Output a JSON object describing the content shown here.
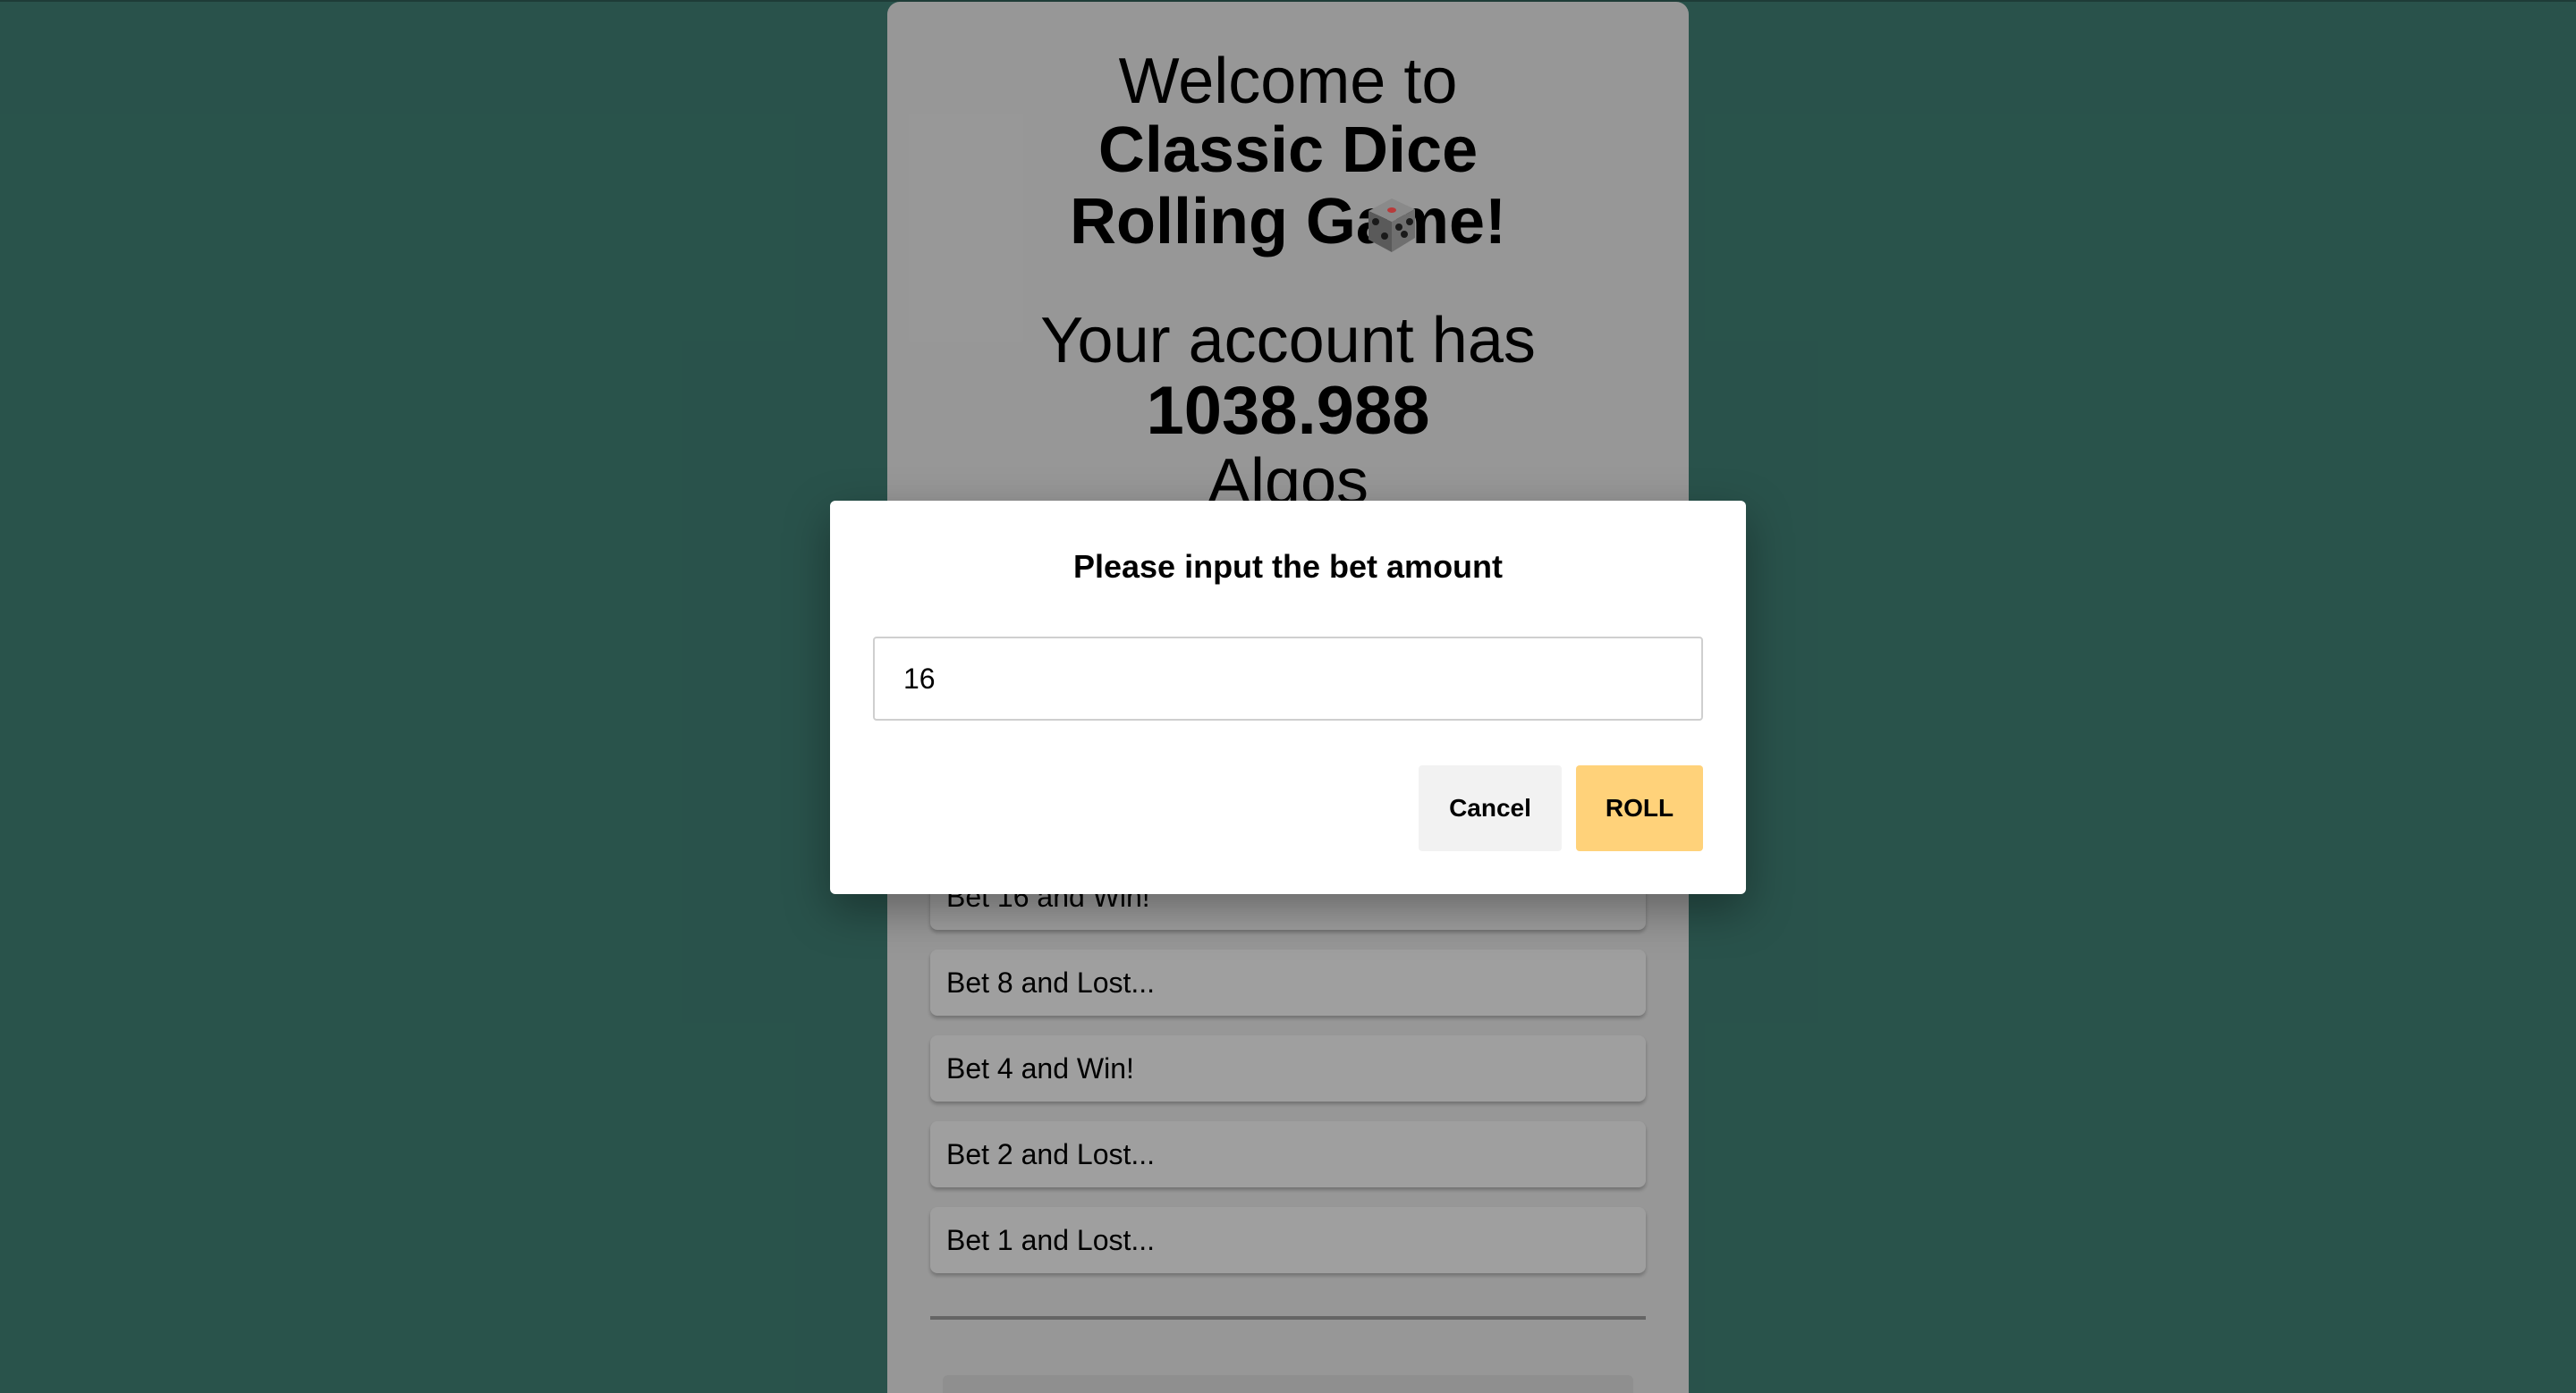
{
  "header": {
    "welcome": "Welcome to",
    "title": "Classic Dice Rolling Game!"
  },
  "account": {
    "prefix": "Your account has",
    "balance": "1038.988",
    "currency": "Algos"
  },
  "history": [
    {
      "text": "Bet 16 and Win!"
    },
    {
      "text": "Bet 8 and Lost..."
    },
    {
      "text": "Bet 4 and Win!"
    },
    {
      "text": "Bet 2 and Lost..."
    },
    {
      "text": "Bet 1 and Lost..."
    }
  ],
  "modal": {
    "title": "Please input the bet amount",
    "input_value": "16",
    "cancel_label": "Cancel",
    "roll_label": "ROLL"
  },
  "colors": {
    "background": "#3f7f73",
    "roll_button": "#ffd27a",
    "cancel_button": "#f2f2f2"
  }
}
